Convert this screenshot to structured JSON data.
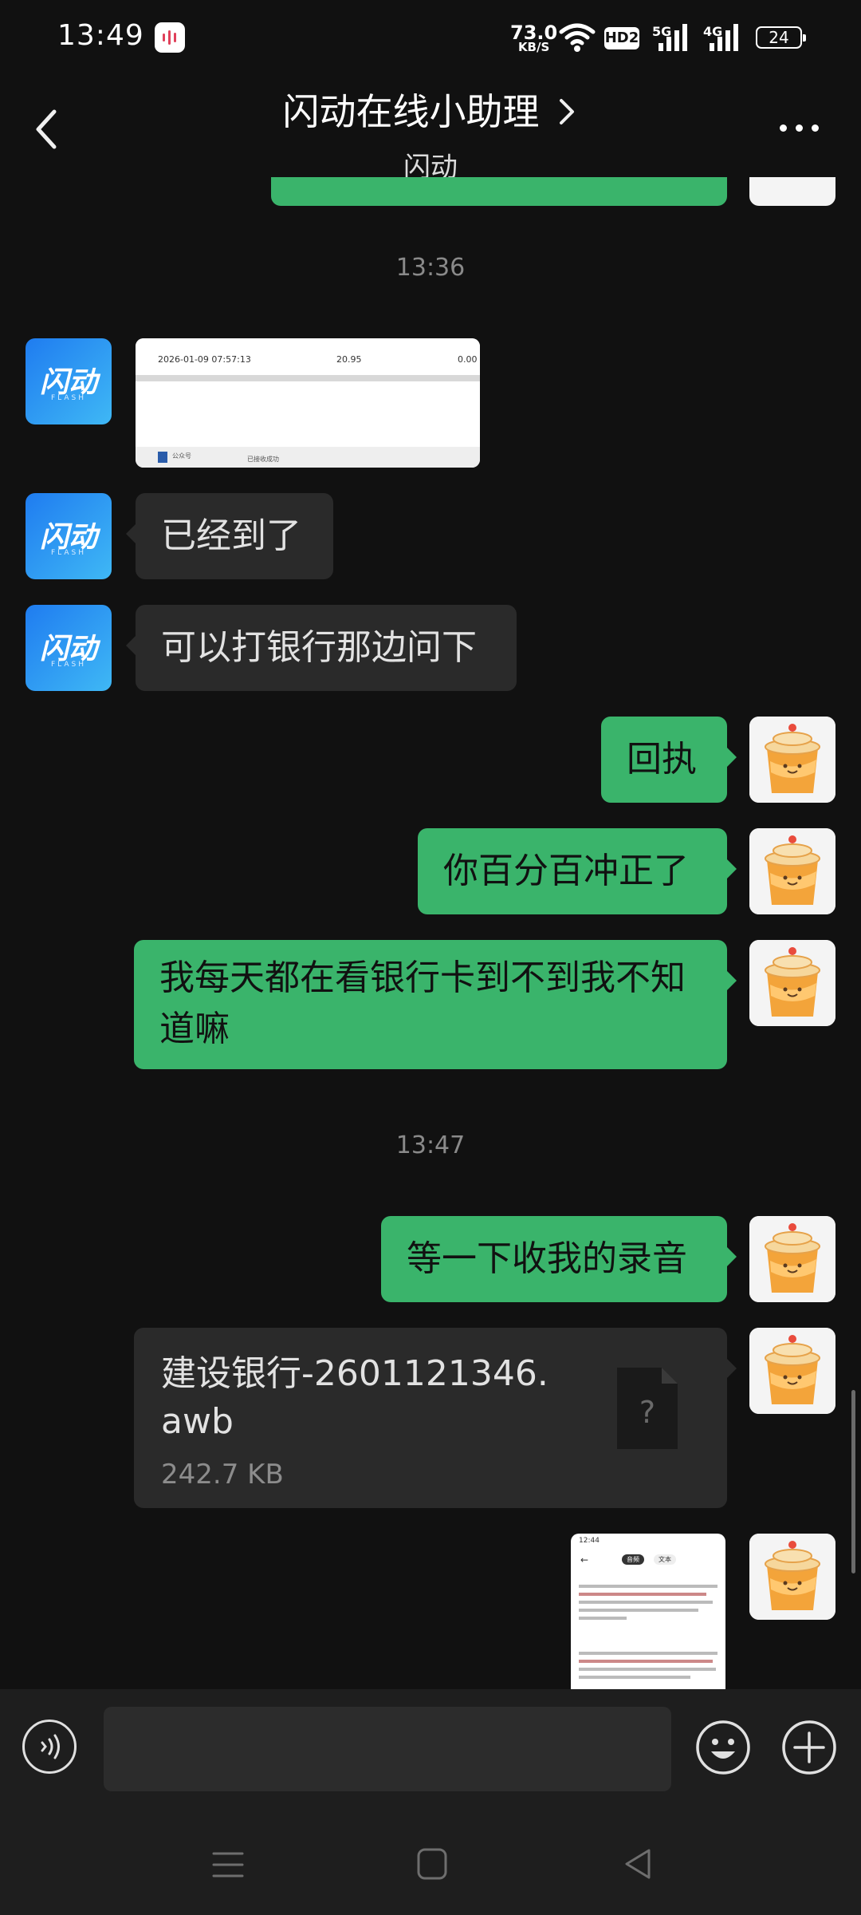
{
  "status_bar": {
    "time": "13:49",
    "net_speed_value": "73.0",
    "net_speed_unit": "KB/S",
    "hd_label": "HD2",
    "sim1_label": "5G",
    "sim2_label": "4G",
    "battery_level": "24",
    "icons": [
      "app-badge-icon",
      "wifi-icon",
      "signal-icon",
      "battery-icon"
    ]
  },
  "header": {
    "title": "闪动在线小助理",
    "subtitle": "闪动",
    "icons": [
      "back-arrow-icon",
      "chevron-right-icon",
      "more-dots-icon"
    ]
  },
  "contact_avatar_text": "闪动",
  "contact_avatar_subtext": "FLASH",
  "messages": [
    {
      "type": "time",
      "text": "13:36"
    },
    {
      "type": "image",
      "side": "left",
      "image_date": "2026-01-09 07:57:13",
      "image_amount": "20.95",
      "image_fee": "0.00",
      "image_label_1": "公众号",
      "image_label_2": "已接收成功"
    },
    {
      "type": "text",
      "side": "left",
      "text": "已经到了"
    },
    {
      "type": "text",
      "side": "left",
      "text": "可以打银行那边问下"
    },
    {
      "type": "text",
      "side": "right",
      "text": "回执"
    },
    {
      "type": "text",
      "side": "right",
      "text": "你百分百冲正了"
    },
    {
      "type": "text",
      "side": "right",
      "text": "我每天都在看银行卡到不到我不知道嘛"
    },
    {
      "type": "time",
      "text": "13:47"
    },
    {
      "type": "text",
      "side": "right",
      "text": "等一下收我的录音"
    },
    {
      "type": "file",
      "side": "right",
      "file_name": "建设银行-2601121346.awb",
      "file_size": "242.7 KB",
      "file_icon_glyph": "?"
    },
    {
      "type": "image",
      "side": "right",
      "image_time": "12:44",
      "image_tab_1": "音频",
      "image_tab_2": "文本"
    }
  ],
  "input": {
    "placeholder": "",
    "icons": [
      "voice-icon",
      "emoji-icon",
      "plus-icon"
    ]
  },
  "nav_bar": {
    "icons": [
      "menu-icon",
      "home-icon",
      "back-triangle-icon"
    ]
  },
  "colors": {
    "background": "#111111",
    "bubble_right": "#3ab46b",
    "bubble_left": "#2a2a2a",
    "avatar_left_start": "#1f7cf0",
    "avatar_left_end": "#3fb8f5"
  }
}
